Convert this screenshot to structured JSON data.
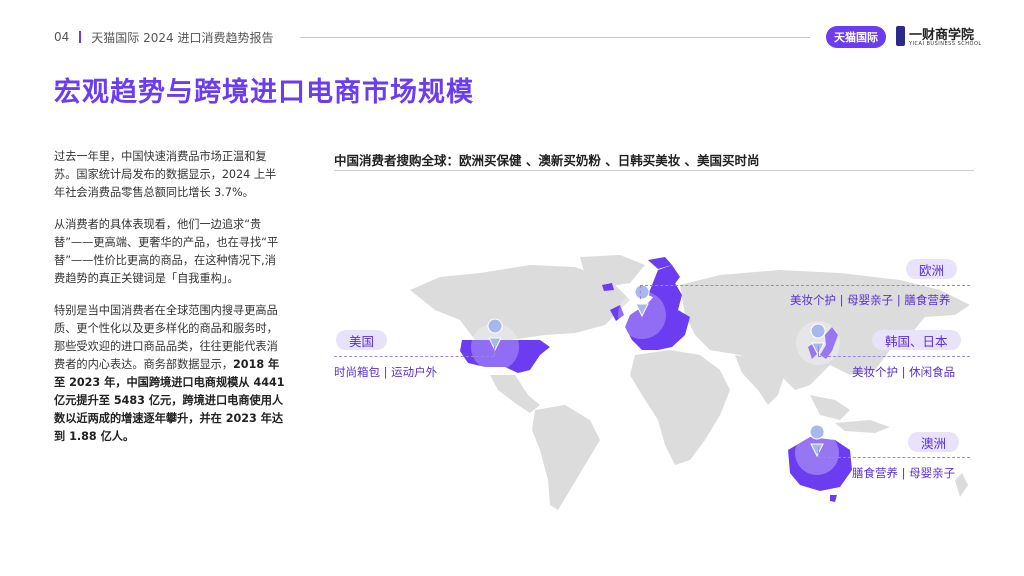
{
  "header": {
    "page_number": "04",
    "report_title": "天猫国际 2024 进口消费趋势报告",
    "logo_tmall": "天猫国际",
    "logo_yicai_cn": "一财商学院",
    "logo_yicai_en": "YICAI BUSINESS SCHOOL"
  },
  "main_title": "宏观趋势与跨境进口电商市场规模",
  "left_text": {
    "p1": "过去一年里，中国快速消费品市场正温和复苏。国家统计局发布的数据显示，2024 上半年社会消费品零售总额同比增长 3.7%。",
    "p2": "从消费者的具体表现看，他们一边追求“贵替”——更高端、更奢华的产品，也在寻找“平替”——性价比更高的商品，在这种情况下,消费趋势的真正关键词是「自我重构」。",
    "p3_normal": "特别是当中国消费者在全球范围内搜寻更高品质、更个性化以及更多样化的商品和服务时，那些受欢迎的进口商品品类，往往更能代表消费者的内心表达。商务部数据显示，",
    "p3_bold": "2018 年至 2023 年，中国跨境进口电商规模从 4441 亿元提升至 5483 亿元，跨境进口电商使用人数以近两成的增速逐年攀升，并在 2023 年达到 1.88 亿人。"
  },
  "map": {
    "title": "中国消费者搜购全球：欧洲买保健 、澳新买奶粉 、日韩买美妆 、美国买时尚",
    "regions": [
      {
        "name": "欧洲",
        "items": "美妆个护 | 母婴亲子 | 膳食营养"
      },
      {
        "name": "美国",
        "items": "时尚箱包 | 运动户外"
      },
      {
        "name": "韩国、日本",
        "items": "美妆个护 | 休闲食品"
      },
      {
        "name": "澳洲",
        "items": "膳食营养 | 母婴亲子"
      }
    ],
    "colors": {
      "highlight": "#6b3cf0",
      "land": "#dcdcdc",
      "tag_bg": "#e9e2fb"
    }
  }
}
